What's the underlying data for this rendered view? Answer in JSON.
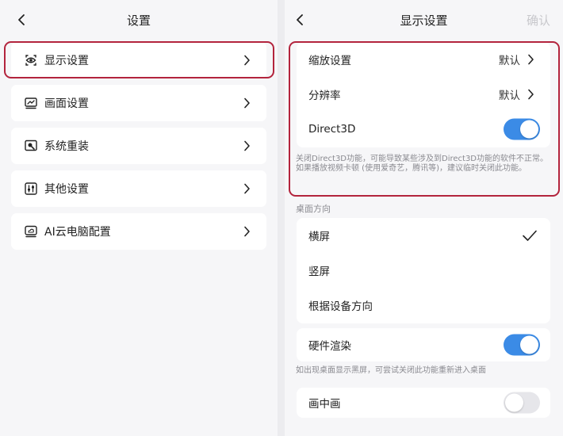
{
  "left": {
    "title": "设置",
    "menu": [
      {
        "label": "显示设置",
        "icon": "eye-icon"
      },
      {
        "label": "画面设置",
        "icon": "monitor-chart-icon"
      },
      {
        "label": "系统重装",
        "icon": "system-reinstall-icon"
      },
      {
        "label": "其他设置",
        "icon": "sliders-icon"
      },
      {
        "label": "AI云电脑配置",
        "icon": "cloud-computer-icon"
      }
    ]
  },
  "right": {
    "title": "显示设置",
    "confirm": "确认",
    "scale": {
      "label": "缩放设置",
      "value": "默认"
    },
    "resolution": {
      "label": "分辨率",
      "value": "默认"
    },
    "direct3d": {
      "label": "Direct3D",
      "enabled": true
    },
    "direct3d_note": "关闭Direct3D功能，可能导致某些涉及到Direct3D功能的软件不正常。如果播放视频卡顿 (使用爱奇艺，腾讯等)，建议临时关闭此功能。",
    "orientation": {
      "section": "桌面方向",
      "options": [
        "横屏",
        "竖屏",
        "根据设备方向"
      ],
      "selected": "横屏"
    },
    "hardware_render": {
      "label": "硬件渲染",
      "enabled": true
    },
    "hardware_note": "如出现桌面显示黑屏，可尝试关闭此功能重新进入桌面",
    "pip": {
      "label": "画中画",
      "enabled": false
    }
  },
  "colors": {
    "highlight": "#b3243d",
    "toggle_on": "#3b8be6",
    "toggle_off": "#e6e6ea",
    "background": "#f6f6f8"
  }
}
